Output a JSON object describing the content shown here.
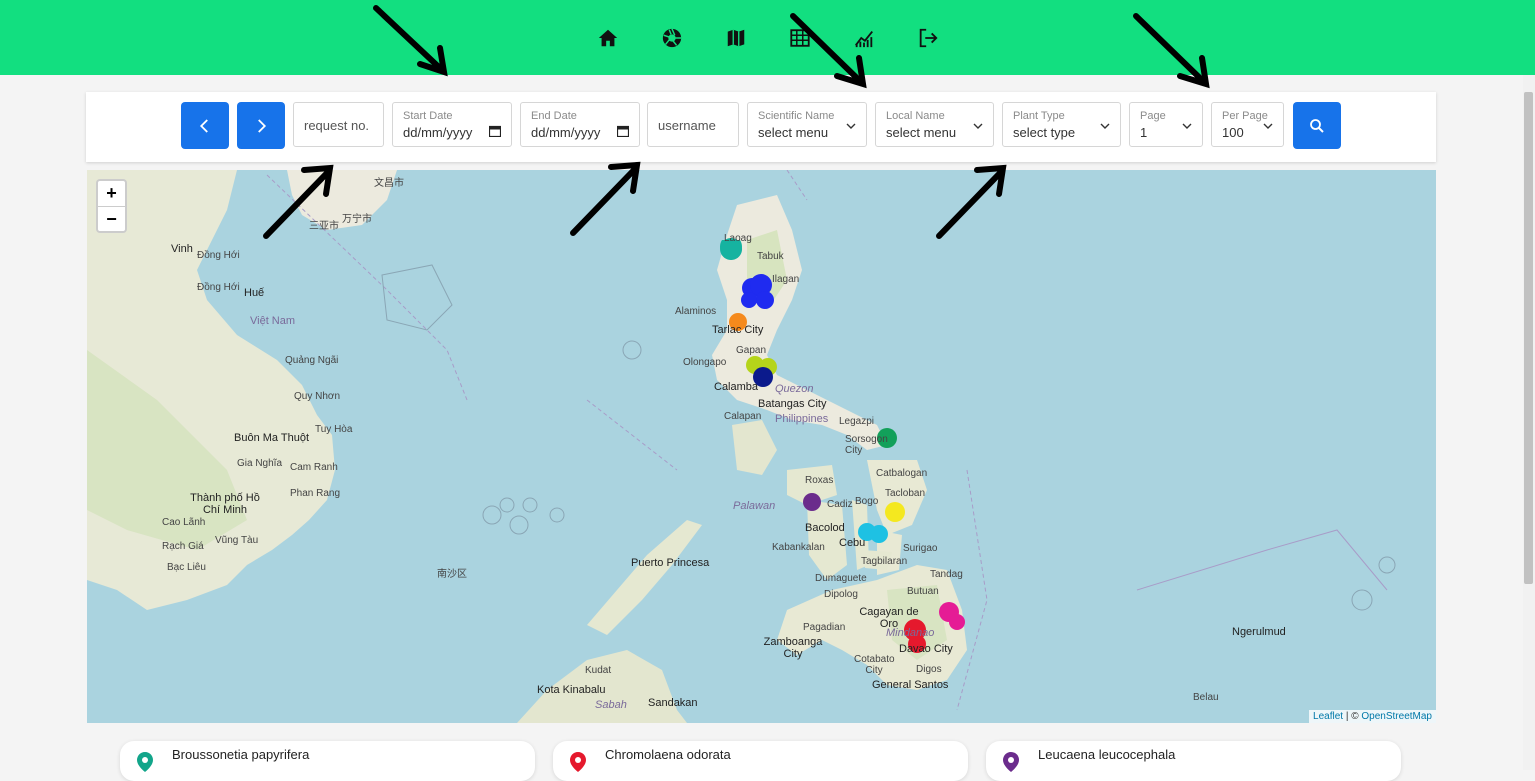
{
  "nav": {
    "items": [
      {
        "icon": "home-icon"
      },
      {
        "icon": "camera-aperture-icon"
      },
      {
        "icon": "map-icon"
      },
      {
        "icon": "table-icon"
      },
      {
        "icon": "chart-icon"
      },
      {
        "icon": "logout-icon"
      }
    ]
  },
  "colors": {
    "topbar": "#12df80",
    "primary": "#1773ea",
    "map_water": "#aad3df",
    "map_land": "#f2efe9"
  },
  "filters": {
    "request_placeholder": "request no.",
    "start_date": {
      "label": "Start Date",
      "value": "dd/mm/yyyy"
    },
    "end_date": {
      "label": "End Date",
      "value": "dd/mm/yyyy"
    },
    "username_placeholder": "username",
    "scientific_name": {
      "label": "Scientific Name",
      "value": "select menu"
    },
    "local_name": {
      "label": "Local Name",
      "value": "select menu"
    },
    "plant_type": {
      "label": "Plant Type",
      "value": "select type"
    },
    "page": {
      "label": "Page",
      "value": "1"
    },
    "per_page": {
      "label": "Per Page",
      "value": "100"
    }
  },
  "map": {
    "zoom_in": "+",
    "zoom_out": "−",
    "attribution_leaflet": "Leaflet",
    "attribution_sep": " | © ",
    "attribution_osm": "OpenStreetMap",
    "labels": {
      "vinh": "Vinh",
      "dong_hoi": "Đồng Hới",
      "hue": "Huế",
      "viet_nam": "Việt Nam",
      "quang_ngai": "Quảng Ngãi",
      "quy_nhon": "Quy Nhơn",
      "buon_ma_thuot": "Buôn Ma Thuột",
      "tuy_hoa": "Tuy Hòa",
      "gia_nghia": "Gia Nghĩa",
      "cam_ranh": "Cam Ranh",
      "phan_rang": "Phan Rang",
      "thanh_pho_hcm": "Thành phố Hồ Chí Minh",
      "cao_lanh": "Cao Lãnh",
      "vung_tau": "Vũng Tàu",
      "rach_gia": "Rạch Giá",
      "bac_lieu": "Bạc Liêu",
      "sanya": "三亚市",
      "wanning": "万宁市",
      "wenchang": "文昌市",
      "laoag": "Laoag",
      "tabuk": "Tabuk",
      "ilagan": "Ilagan",
      "alaminos": "Alaminos",
      "tarlac": "Tarlac City",
      "gapan": "Gapan",
      "olongapo": "Olongapo",
      "calamba": "Calamba",
      "batangas": "Batangas City",
      "quezon": "Quezon",
      "philippines": "Philippines",
      "calapan": "Calapan",
      "legazpi": "Legazpi",
      "sorsogon": "Sorsogon City",
      "catbalogan": "Catbalogan",
      "tacloban": "Tacloban",
      "roxas": "Roxas",
      "cadiz": "Cadiz",
      "bogo": "Bogo",
      "bacolod": "Bacolod",
      "kabankalan": "Kabankalan",
      "cebu": "Cebu",
      "tagbilaran": "Tagbilaran",
      "surigao": "Surigao",
      "puerto_princesa": "Puerto Princesa",
      "dumaguete": "Dumaguete",
      "dipolog": "Dipolog",
      "tandag": "Tandag",
      "butuan": "Butuan",
      "cagayan": "Cagayan de Oro",
      "pagadian": "Pagadian",
      "zamboanga": "Zamboanga City",
      "mindanao": "Mindanao",
      "davao": "Davao City",
      "cotabato": "Cotabato City",
      "digos": "Digos",
      "gensan": "General Santos",
      "kudat": "Kudat",
      "kota_kinabalu": "Kota Kinabalu",
      "sandakan": "Sandakan",
      "sabah": "Sabah",
      "palawan": "Palawan",
      "ngerulmud": "Ngerulmud",
      "belau": "Belau",
      "spratly": "南沙区"
    }
  },
  "legend": [
    {
      "name": "Broussonetia papyrifera",
      "sub": "",
      "color": "#12a58a"
    },
    {
      "name": "Chromolaena odorata",
      "sub": "",
      "color": "#e5192d"
    },
    {
      "name": "Leucaena leucocephala",
      "sub": "",
      "color": "#6b2c8c"
    }
  ]
}
